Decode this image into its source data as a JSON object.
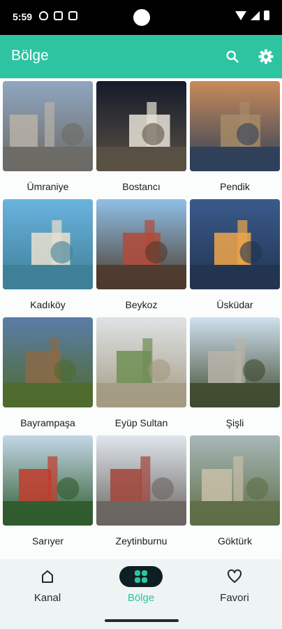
{
  "status_bar": {
    "time": "5:59"
  },
  "app_bar": {
    "title": "Bölge"
  },
  "regions": [
    {
      "name": "Ümraniye",
      "sky": "#8fa6c2",
      "ground": "#6d6a65",
      "accent": "#b7b1a7"
    },
    {
      "name": "Bostancı",
      "sky": "#151b2a",
      "ground": "#5a5145",
      "accent": "#e8e3d7"
    },
    {
      "name": "Pendik",
      "sky": "#c98b5a",
      "ground": "#2e3f5a",
      "accent": "#a68a66"
    },
    {
      "name": "Kadıköy",
      "sky": "#6ab3df",
      "ground": "#3e7f97",
      "accent": "#e8dfcf"
    },
    {
      "name": "Beykoz",
      "sky": "#8fc0e6",
      "ground": "#4c3a2c",
      "accent": "#b24a3a"
    },
    {
      "name": "Üsküdar",
      "sky": "#3a5a8c",
      "ground": "#22344f",
      "accent": "#f0a64a"
    },
    {
      "name": "Bayrampaşa",
      "sky": "#5a7da8",
      "ground": "#4f6a2c",
      "accent": "#8a6a48"
    },
    {
      "name": "Eyüp Sultan",
      "sky": "#dfe3e6",
      "ground": "#a49a82",
      "accent": "#6f8f54"
    },
    {
      "name": "Şişli",
      "sky": "#cfe0ef",
      "ground": "#3f4a2f",
      "accent": "#b7b3a8"
    },
    {
      "name": "Sarıyer",
      "sky": "#c3d7e8",
      "ground": "#2f5a2c",
      "accent": "#c23c2c"
    },
    {
      "name": "Zeytinburnu",
      "sky": "#dfe6ec",
      "ground": "#6a6461",
      "accent": "#a2453a"
    },
    {
      "name": "Göktürk",
      "sky": "#a7b7b8",
      "ground": "#5e6e46",
      "accent": "#c9bfa8"
    }
  ],
  "bottom_nav": {
    "items": [
      {
        "label": "Kanal",
        "icon": "home-icon",
        "active": false
      },
      {
        "label": "Bölge",
        "icon": "grid-icon",
        "active": true
      },
      {
        "label": "Favori",
        "icon": "heart-icon",
        "active": false
      }
    ]
  },
  "colors": {
    "primary": "#2ec4a2",
    "nav_active_pill": "#0d1f23"
  }
}
